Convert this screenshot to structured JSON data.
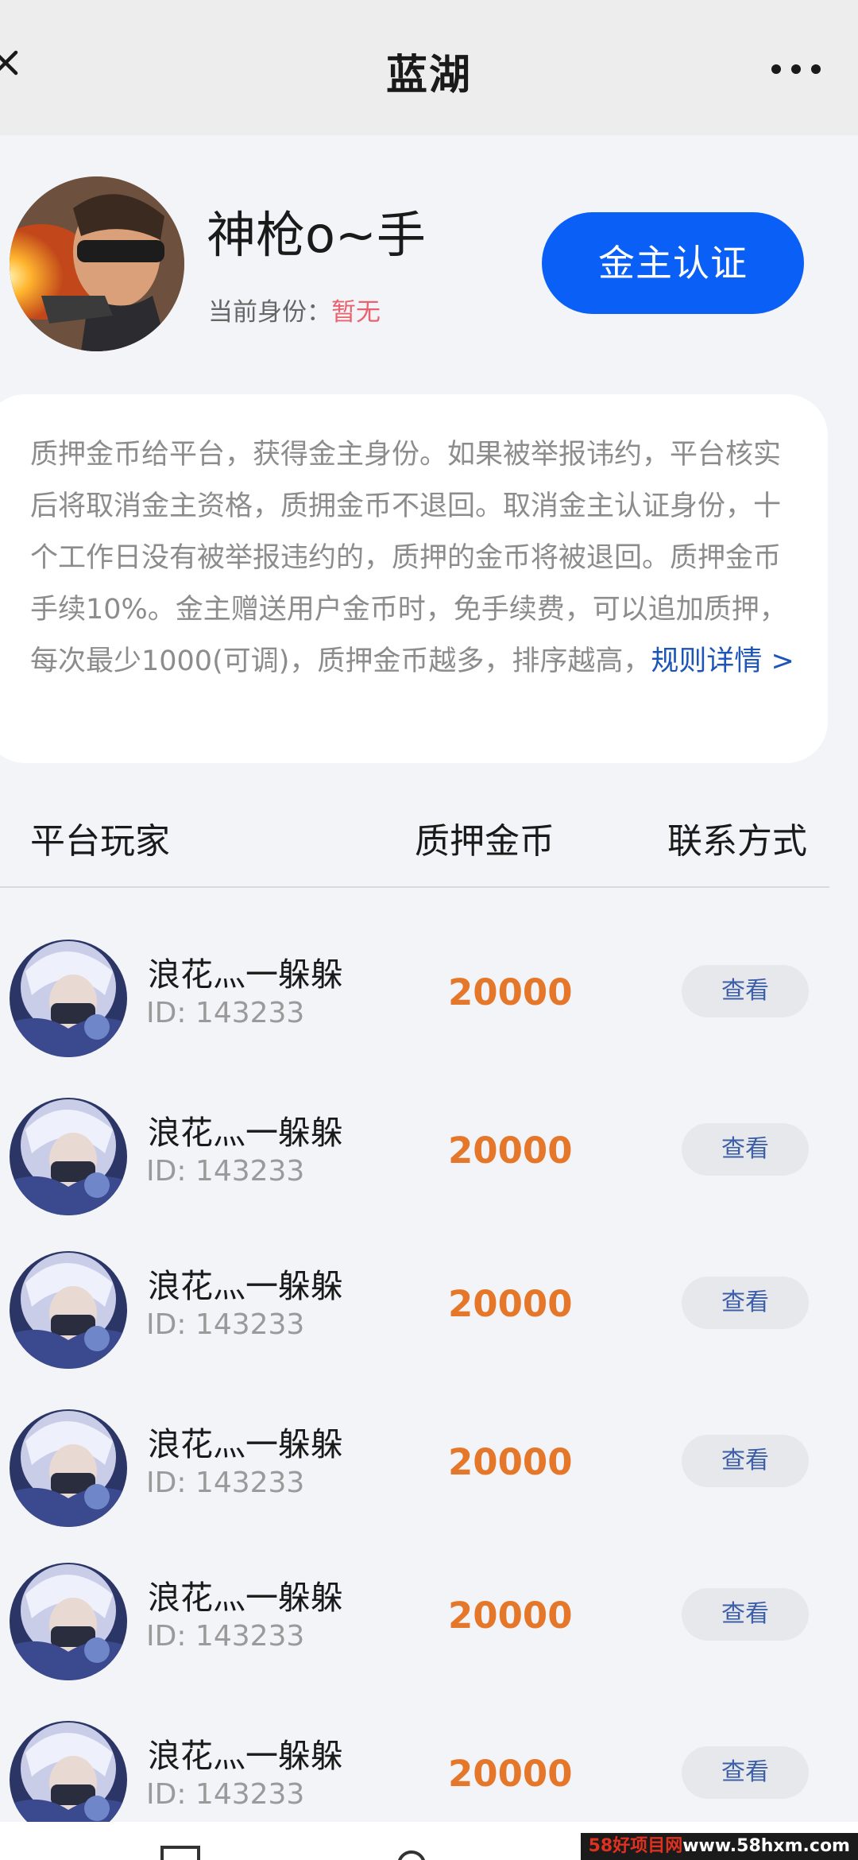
{
  "titlebar": {
    "title": "蓝湖",
    "back_icon": "close-x-icon",
    "more_icon": "more-dots-icon"
  },
  "profile": {
    "name": "神枪o~手",
    "identity_label": "当前身份：",
    "identity_value": "暂无",
    "certify_button": "金主认证"
  },
  "info": {
    "text": "质押金币给平台，获得金主身份。如果被举报讳约，平台核实后将取消金主资格，质拥金币不退回。取消金主认证身份，十个工作日没有被举报违约的，质押的金币将被退回。质押金币手续10%。金主赠送用户金币时，免手续费，可以追加质押，每次最少1000(可调)，质押金币越多，排序越高，",
    "rule_link": "规则详情 >"
  },
  "list_header": {
    "player": "平台玩家",
    "coin": "质押金币",
    "contact": "联系方式"
  },
  "rows": [
    {
      "name": "浪花灬一躲躲",
      "id": "ID: 143233",
      "coin": "20000",
      "button": "查看"
    },
    {
      "name": "浪花灬一躲躲",
      "id": "ID: 143233",
      "coin": "20000",
      "button": "查看"
    },
    {
      "name": "浪花灬一躲躲",
      "id": "ID: 143233",
      "coin": "20000",
      "button": "查看"
    },
    {
      "name": "浪花灬一躲躲",
      "id": "ID: 143233",
      "coin": "20000",
      "button": "查看"
    },
    {
      "name": "浪花灬一躲躲",
      "id": "ID: 143233",
      "coin": "20000",
      "button": "查看"
    },
    {
      "name": "浪花灬一躲躲",
      "id": "ID: 143233",
      "coin": "20000",
      "button": "查看"
    }
  ],
  "watermark": {
    "brand": "58好项目网",
    "url": "www.58hxm.com"
  },
  "colors": {
    "primary_blue": "#0a60f6",
    "coin_orange": "#e5772a",
    "status_red": "#e8636f",
    "link_blue": "#1c54b8"
  }
}
